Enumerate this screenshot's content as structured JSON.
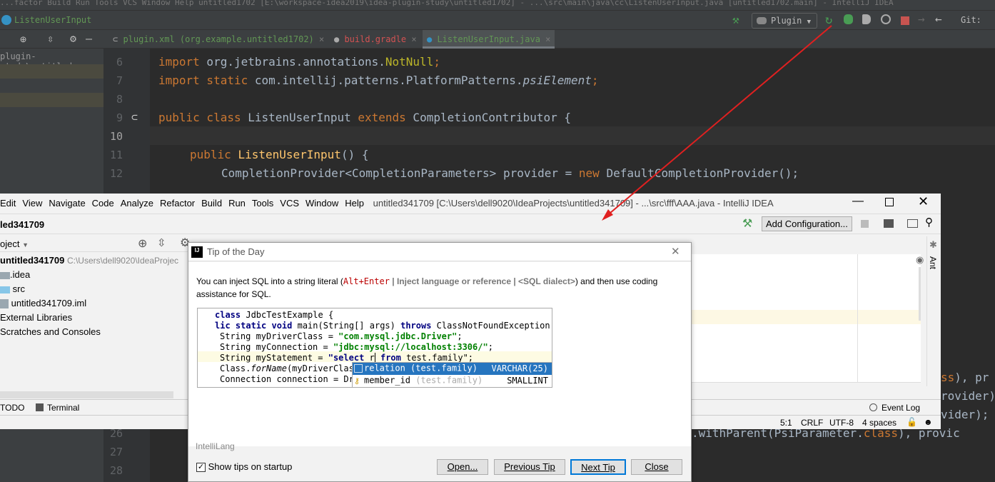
{
  "bg_ide": {
    "title": "...factor  Build  Run  Tools  VCS  Window  Help   untitled1702 [E:\\workspace-idea2019\\idea-plugin-study\\untitled1702] - ...\\src\\main\\java\\cc\\ListenUserInput.java [untitled1702.main] - IntelliJ IDEA",
    "breadcrumb": "ListenUserInput",
    "run_config": "Plugin",
    "git_label": "Git:",
    "project_path": "plugin-study\\untitled",
    "tabs": [
      {
        "label": "plugin.xml (org.example.untitled1702)",
        "color": "#629755"
      },
      {
        "label": "build.gradle",
        "color": "#d25252"
      },
      {
        "label": "ListenUserInput.java",
        "color": "#629755",
        "active": true
      }
    ],
    "line_numbers": [
      "6",
      "7",
      "8",
      "9",
      "10",
      "11",
      "12",
      "26",
      "27",
      "28"
    ],
    "code": {
      "l6": [
        "import",
        " org.jetbrains.annotations.",
        "NotNull",
        ";"
      ],
      "l7": [
        "import static",
        " com.intellij.patterns.PlatformPatterns.",
        "psiElement",
        ";"
      ],
      "l9": [
        "public class",
        " ListenUserInput ",
        "extends",
        " CompletionContributor {"
      ],
      "l11": [
        "public",
        " ",
        "ListenUserInput",
        "() {"
      ],
      "l12": [
        "CompletionProvider<CompletionParameters> provider = ",
        "new",
        " DefaultCompletionProvider();"
      ],
      "r1a": "ss",
      "r1b": "), pr",
      "r2": "rovider)",
      "r3": "vider);",
      "l26a": ".withParent(PsiParameter.",
      "l26b": "class",
      "l26c": "), provic"
    }
  },
  "ide_window": {
    "menu": [
      "Edit",
      "View",
      "Navigate",
      "Code",
      "Analyze",
      "Refactor",
      "Build",
      "Run",
      "Tools",
      "VCS",
      "Window",
      "Help"
    ],
    "title": "untitled341709 [C:\\Users\\dell9020\\IdeaProjects\\untitled341709] - ...\\src\\fff\\AAA.java - IntelliJ IDEA",
    "project_name": "led341709",
    "add_config": "Add Configuration...",
    "project_view": "oject",
    "tree": [
      {
        "label": "untitled341709",
        "path": "C:\\Users\\dell9020\\IdeaProjec"
      },
      {
        "label": ".idea"
      },
      {
        "label": "src"
      },
      {
        "label": "untitled341709.iml"
      },
      {
        "label": "External Libraries"
      },
      {
        "label": "Scratches and Consoles"
      }
    ],
    "bottom_tools": [
      "TODO",
      "Terminal"
    ],
    "event_log": "Event Log",
    "ant": "Ant",
    "status": {
      "position": "5:1",
      "line_sep": "CRLF",
      "encoding": "UTF-8",
      "indent": "4 spaces"
    }
  },
  "dialog": {
    "title": "Tip of the Day",
    "text_1": "You can inject SQL into a string literal (",
    "shortcut": "Alt+Enter",
    "text_2": " | Inject language or reference | <SQL dialect>",
    "text_3": ") and then use coding assistance for SQL.",
    "code": [
      [
        "class",
        " JdbcTestExample {"
      ],
      [
        "lic static void",
        " main(String[] args) ",
        "throws",
        " ClassNotFoundException, S"
      ],
      [
        "String myDriverClass = ",
        "\"com.mysql.jdbc.Driver\"",
        ";"
      ],
      [
        "String myConnection = ",
        "\"jdbc:mysql://localhost:3306/\"",
        ";"
      ],
      [
        "String myStatement = ",
        "\"select ",
        "r",
        " from",
        " test.family\";"
      ],
      [
        "Class.",
        "forName",
        "(myDriverClas"
      ],
      [
        "Connection connection = Dr"
      ]
    ],
    "completion": [
      {
        "name": "relation",
        "source": "(test.family)",
        "type": "VARCHAR(25)",
        "selected": true
      },
      {
        "name": "member_id",
        "source": "(test.family)",
        "type": "SMALLINT"
      }
    ],
    "plugin": "IntelliLang",
    "show_tips": {
      "label": "Show tips on startup",
      "checked": true
    },
    "buttons": {
      "open": "Open...",
      "previous": "Previous Tip",
      "next": "Next Tip",
      "close": "Close"
    }
  },
  "colors": {
    "annotation_arrow": "#e02020",
    "selection": "#2675bf"
  }
}
